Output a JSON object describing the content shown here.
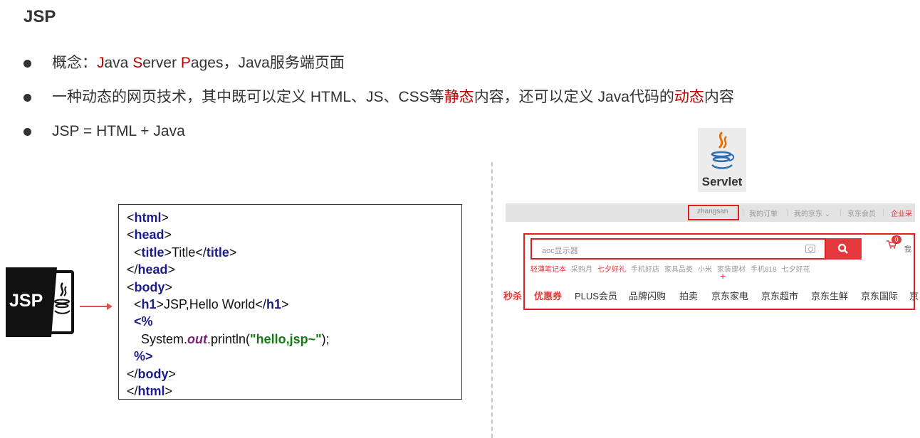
{
  "slide": {
    "title": "JSP",
    "bullets": [
      {
        "parts": [
          "概念：",
          "J",
          "ava ",
          "S",
          "erver ",
          "P",
          "ages，Java服务端页面"
        ]
      },
      {
        "parts": [
          "一种动态的网页技术，其中既可以定义 HTML、JS、CSS等",
          "静态",
          "内容，还可以定义 Java代码的",
          "动态",
          "内容"
        ]
      },
      {
        "parts": [
          "JSP = HTML + Java"
        ]
      }
    ]
  },
  "logos": {
    "servlet_label": "Servlet",
    "jsp_label": "JSP",
    "servlet_icon": "java-coffee-icon",
    "jsp_icon": "jsp-file-icon"
  },
  "code": {
    "lines": [
      [
        "<",
        "html",
        ">"
      ],
      [
        "<",
        "head",
        ">"
      ],
      [
        "  <",
        "title",
        ">Title</",
        "title",
        ">"
      ],
      [
        "</",
        "head",
        ">"
      ],
      [
        "<",
        "body",
        ">"
      ],
      [
        "  <",
        "h1",
        ">JSP,Hello World</",
        "h1",
        ">"
      ],
      [
        "  <%"
      ],
      [
        "    System.",
        "out",
        ".println(",
        "\"hello,jsp~\"",
        ");"
      ],
      [
        "  %>"
      ],
      [
        "</",
        "body",
        ">"
      ],
      [
        "</",
        "html",
        ">"
      ]
    ]
  },
  "jd": {
    "topbar": {
      "user": "zhangsan",
      "links": [
        "我的订单",
        "我的京东 ⌄",
        "京东会员",
        "企业采"
      ]
    },
    "search": {
      "placeholder": "aoc显示器",
      "cart_count": "0",
      "cart_text": "我"
    },
    "hot_words": [
      "轻薄笔记本",
      "采购月",
      "七夕好礼",
      "手机好店",
      "家具品类",
      "小米",
      "家装建材",
      "手机818",
      "七夕好花"
    ],
    "plus": "+",
    "nav": [
      "秒杀",
      "优惠券",
      "PLUS会员",
      "品牌闪购",
      "拍卖",
      "京东家电",
      "京东超市",
      "京东生鲜",
      "京东国际",
      "京"
    ]
  },
  "colors": {
    "accent_red": "#c00000",
    "jd_red": "#e4393c",
    "code_tag": "#1c1c8c",
    "code_string": "#137a13",
    "code_field": "#7a1f7a"
  }
}
